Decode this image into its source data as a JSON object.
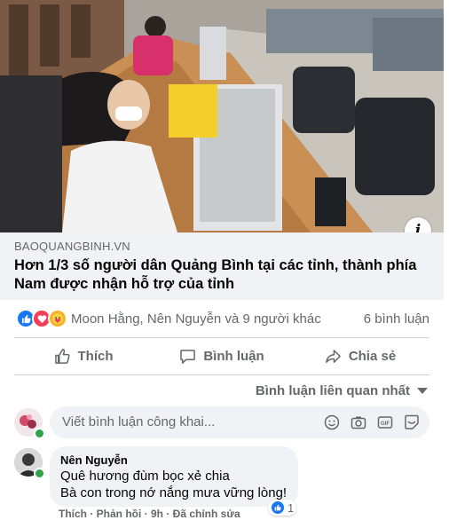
{
  "link_preview": {
    "domain": "BAOQUANGBINH.VN",
    "title": "Hơn 1/3 số người dân Quảng Bình tại các tỉnh, thành phía Nam được nhận hỗ trợ của tỉnh",
    "info_icon": "info-icon"
  },
  "reactions": {
    "icons": [
      "like-reaction-icon",
      "love-reaction-icon",
      "care-reaction-icon"
    ],
    "names": "Moon Hằng, Nên Nguyễn và 9 người khác",
    "comment_count": "6 bình luận"
  },
  "actions": {
    "like": "Thích",
    "comment": "Bình luận",
    "share": "Chia sẻ"
  },
  "sort": {
    "label": "Bình luận liên quan nhất"
  },
  "composer": {
    "placeholder": "Viết bình luận công khai...",
    "icons": [
      "emoji-icon",
      "camera-icon",
      "gif-icon",
      "sticker-icon"
    ]
  },
  "comment": {
    "author": "Nên Nguyễn",
    "line1": "Quê hương đùm bọc xẻ chia",
    "line2": "Bà con trong nớ nắng mưa vững lòng!",
    "reaction_count": "1",
    "meta": "Thích · Phản hồi · 9h · Đã chỉnh sửa"
  },
  "colors": {
    "like_blue": "#1877f2",
    "love_red": "#f33e58",
    "care_yellow": "#f7b125",
    "online_green": "#31a24c",
    "secondary_text": "#65676b"
  }
}
